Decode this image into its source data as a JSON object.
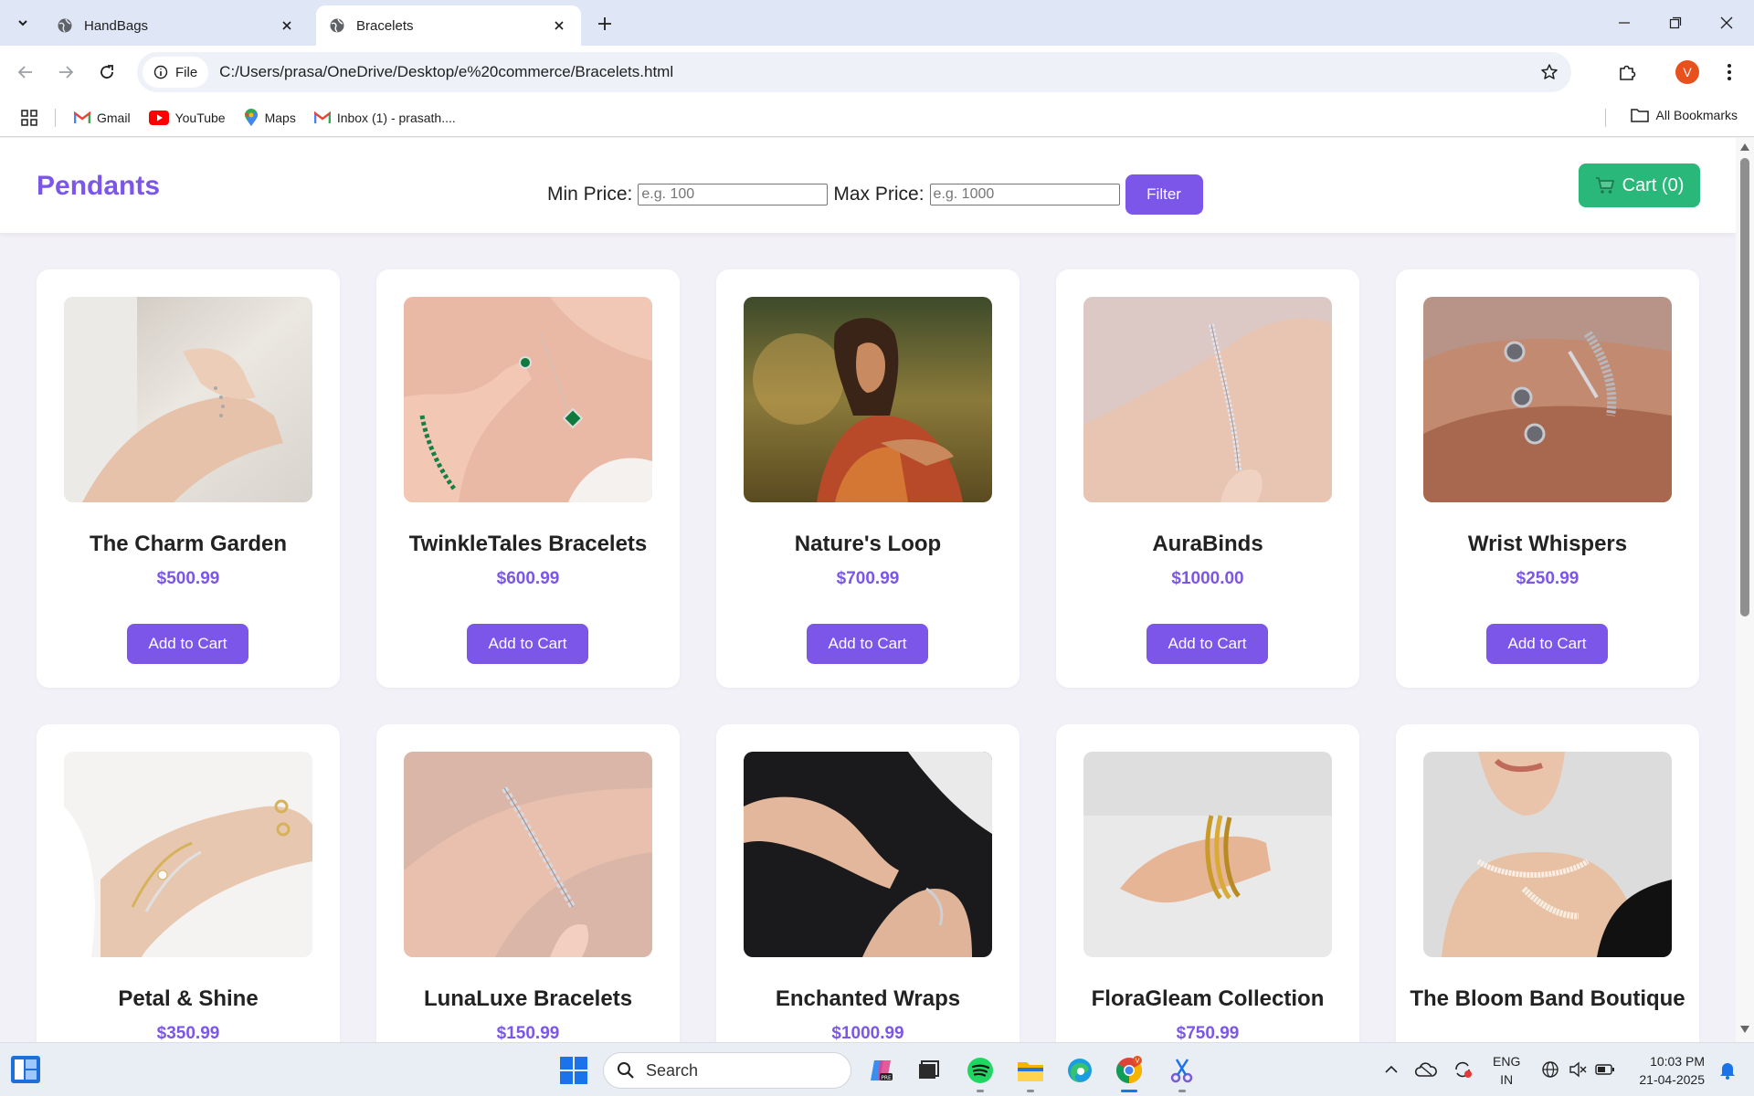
{
  "browser": {
    "tabs": [
      {
        "title": "HandBags",
        "icon": "globe-icon"
      },
      {
        "title": "Bracelets",
        "icon": "globe-icon"
      }
    ],
    "omnibox": {
      "scheme_label": "File",
      "url": "C:/Users/prasa/OneDrive/Desktop/e%20commerce/Bracelets.html"
    },
    "profile_initial": "V",
    "bookmarks": [
      {
        "label": "Gmail",
        "icon": "gmail-icon"
      },
      {
        "label": "YouTube",
        "icon": "youtube-icon"
      },
      {
        "label": "Maps",
        "icon": "maps-icon"
      },
      {
        "label": "Inbox (1) - prasath....",
        "icon": "gmail-icon"
      }
    ],
    "all_bookmarks_label": "All Bookmarks"
  },
  "page": {
    "brand": "Pendants",
    "filter": {
      "min_label": "Min Price:",
      "min_placeholder": "e.g. 100",
      "max_label": "Max Price:",
      "max_placeholder": "e.g. 1000",
      "button": "Filter"
    },
    "cart": {
      "icon": "cart-icon",
      "label": "Cart (0)"
    },
    "add_to_cart_label": "Add to Cart",
    "products": [
      {
        "name": "The Charm Garden",
        "price": "$500.99"
      },
      {
        "name": "TwinkleTales Bracelets",
        "price": "$600.99"
      },
      {
        "name": "Nature's Loop",
        "price": "$700.99"
      },
      {
        "name": "AuraBinds",
        "price": "$1000.00"
      },
      {
        "name": "Wrist Whispers",
        "price": "$250.99"
      },
      {
        "name": "Petal & Shine",
        "price": "$350.99"
      },
      {
        "name": "LunaLuxe Bracelets",
        "price": "$150.99"
      },
      {
        "name": "Enchanted Wraps",
        "price": "$1000.99"
      },
      {
        "name": "FloraGleam Collection",
        "price": "$750.99"
      },
      {
        "name": "The Bloom Band Boutique",
        "price": ""
      }
    ]
  },
  "taskbar": {
    "search_placeholder": "Search",
    "lang_line1": "ENG",
    "lang_line2": "IN",
    "time": "10:03 PM",
    "date": "21-04-2025"
  },
  "colors": {
    "accent": "#7b56e8",
    "cart_green": "#2ab87a"
  }
}
